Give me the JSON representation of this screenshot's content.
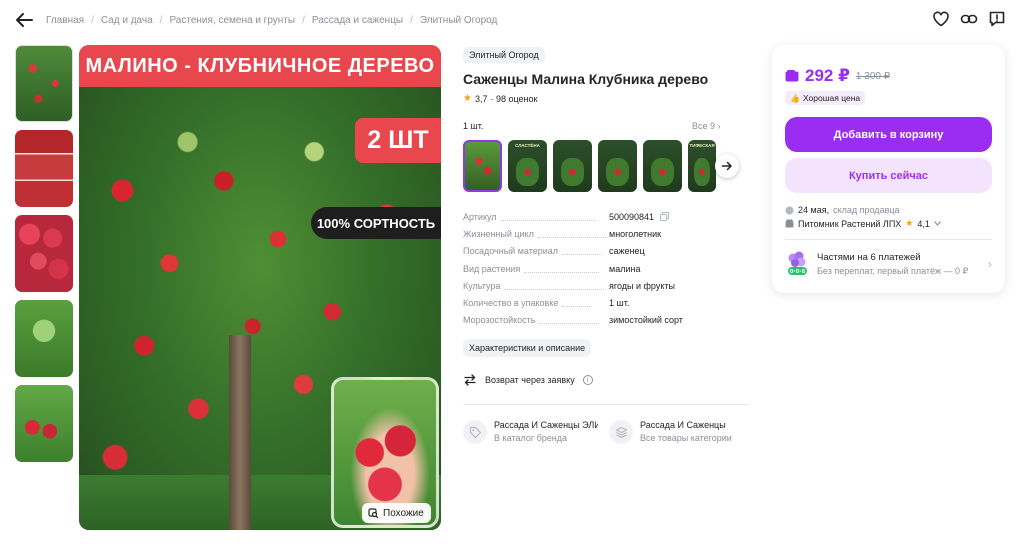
{
  "breadcrumbs": [
    "Главная",
    "Сад и дача",
    "Растения, семена и грунты",
    "Рассада и саженцы",
    "Элитный Огород"
  ],
  "gallery": {
    "banner_text": "МАЛИНО - КЛУБНИЧНОЕ ДЕРЕВО",
    "badge_count": "2 ШТ",
    "badge_sort": "100% СОРТНОСТЬ",
    "similar_label": "Похожие"
  },
  "product": {
    "brand": "Элитный Огород",
    "title": "Саженцы Малина Клубника дерево",
    "rating": "3,7",
    "reviews": "· 98 оценок",
    "qty_label": "1 шт.",
    "see_all": "Все 9 ›",
    "variant_labels": [
      "",
      "СЛАСТЁНА",
      "",
      "",
      "",
      "ТИФЕСКАЯ"
    ]
  },
  "specs": [
    {
      "name": "Артикул",
      "value": "500090841"
    },
    {
      "name": "Жизненный цикл",
      "value": "многолетник"
    },
    {
      "name": "Посадочный материал",
      "value": "саженец"
    },
    {
      "name": "Вид растения",
      "value": "малина"
    },
    {
      "name": "Культура",
      "value": "ягоды и фрукты"
    },
    {
      "name": "Количество в упаковке",
      "value": "1 шт."
    },
    {
      "name": "Морозостойкость",
      "value": "зимостойкий сорт"
    }
  ],
  "characteristics_button": "Характеристики и описание",
  "return_text": "Возврат через заявку",
  "links": [
    {
      "title": "Рассада И Саженцы ЭЛИТНЫЙ",
      "sub": "В каталог бренда"
    },
    {
      "title": "Рассада И Саженцы",
      "sub": "Все товары категории"
    }
  ],
  "buy": {
    "price": "292 ₽",
    "old_price": "1 300 ₽",
    "good_price": "Хорошая цена",
    "cart_button": "Добавить в корзину",
    "buy_now_button": "Купить сейчас",
    "delivery_date": "24 мая,",
    "delivery_note": "склад продавца",
    "seller_name": "Питомник Растений ЛПХ",
    "seller_rating": "4,1",
    "installment_title": "Частями на 6 платежей",
    "installment_sub": "Без переплат, первый платёж — 0 ₽"
  },
  "colors": {
    "accent": "#9b2df0",
    "banner": "#e8484d",
    "star": "#ff9f1a"
  }
}
